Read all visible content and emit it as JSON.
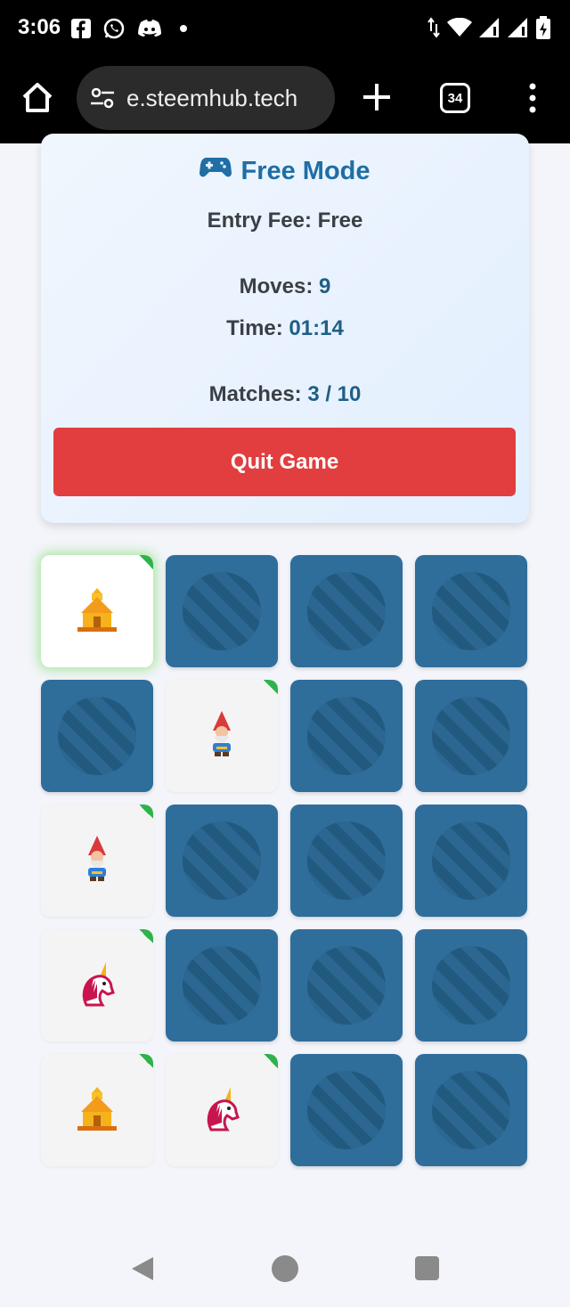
{
  "status_bar": {
    "time": "3:06",
    "icons": [
      "facebook-icon",
      "whatsapp-icon",
      "discord-icon",
      "notification-dot-icon"
    ],
    "right_icons": [
      "data-arrows-icon",
      "wifi-icon",
      "signal-icon",
      "signal-icon",
      "battery-icon"
    ]
  },
  "browser": {
    "url_text": "e.steemhub.tech",
    "tab_count": "34"
  },
  "panel": {
    "mode_title": "Free Mode",
    "entry_fee_label": "Entry Fee: Free",
    "moves_label": "Moves:",
    "moves_value": "9",
    "time_label": "Time:",
    "time_value": "01:14",
    "matches_label": "Matches:",
    "matches_value": "3 / 10",
    "quit_label": "Quit Game"
  },
  "grid": {
    "columns": 4,
    "rows": 5,
    "cards": [
      {
        "state": "up",
        "icon": "temple-icon",
        "glow": true
      },
      {
        "state": "down"
      },
      {
        "state": "down"
      },
      {
        "state": "down"
      },
      {
        "state": "down"
      },
      {
        "state": "up",
        "icon": "gnome-icon"
      },
      {
        "state": "down"
      },
      {
        "state": "down"
      },
      {
        "state": "up",
        "icon": "gnome-icon"
      },
      {
        "state": "down"
      },
      {
        "state": "down"
      },
      {
        "state": "down"
      },
      {
        "state": "up",
        "icon": "unicorn-icon"
      },
      {
        "state": "down"
      },
      {
        "state": "down"
      },
      {
        "state": "down"
      },
      {
        "state": "up",
        "icon": "temple-icon"
      },
      {
        "state": "up",
        "icon": "unicorn-icon"
      },
      {
        "state": "down"
      },
      {
        "state": "down"
      }
    ]
  },
  "colors": {
    "accent": "#1f6ea5",
    "quit_button": "#e23e3f",
    "card_back": "#2f6d9b",
    "match_marker": "#2db34a"
  }
}
